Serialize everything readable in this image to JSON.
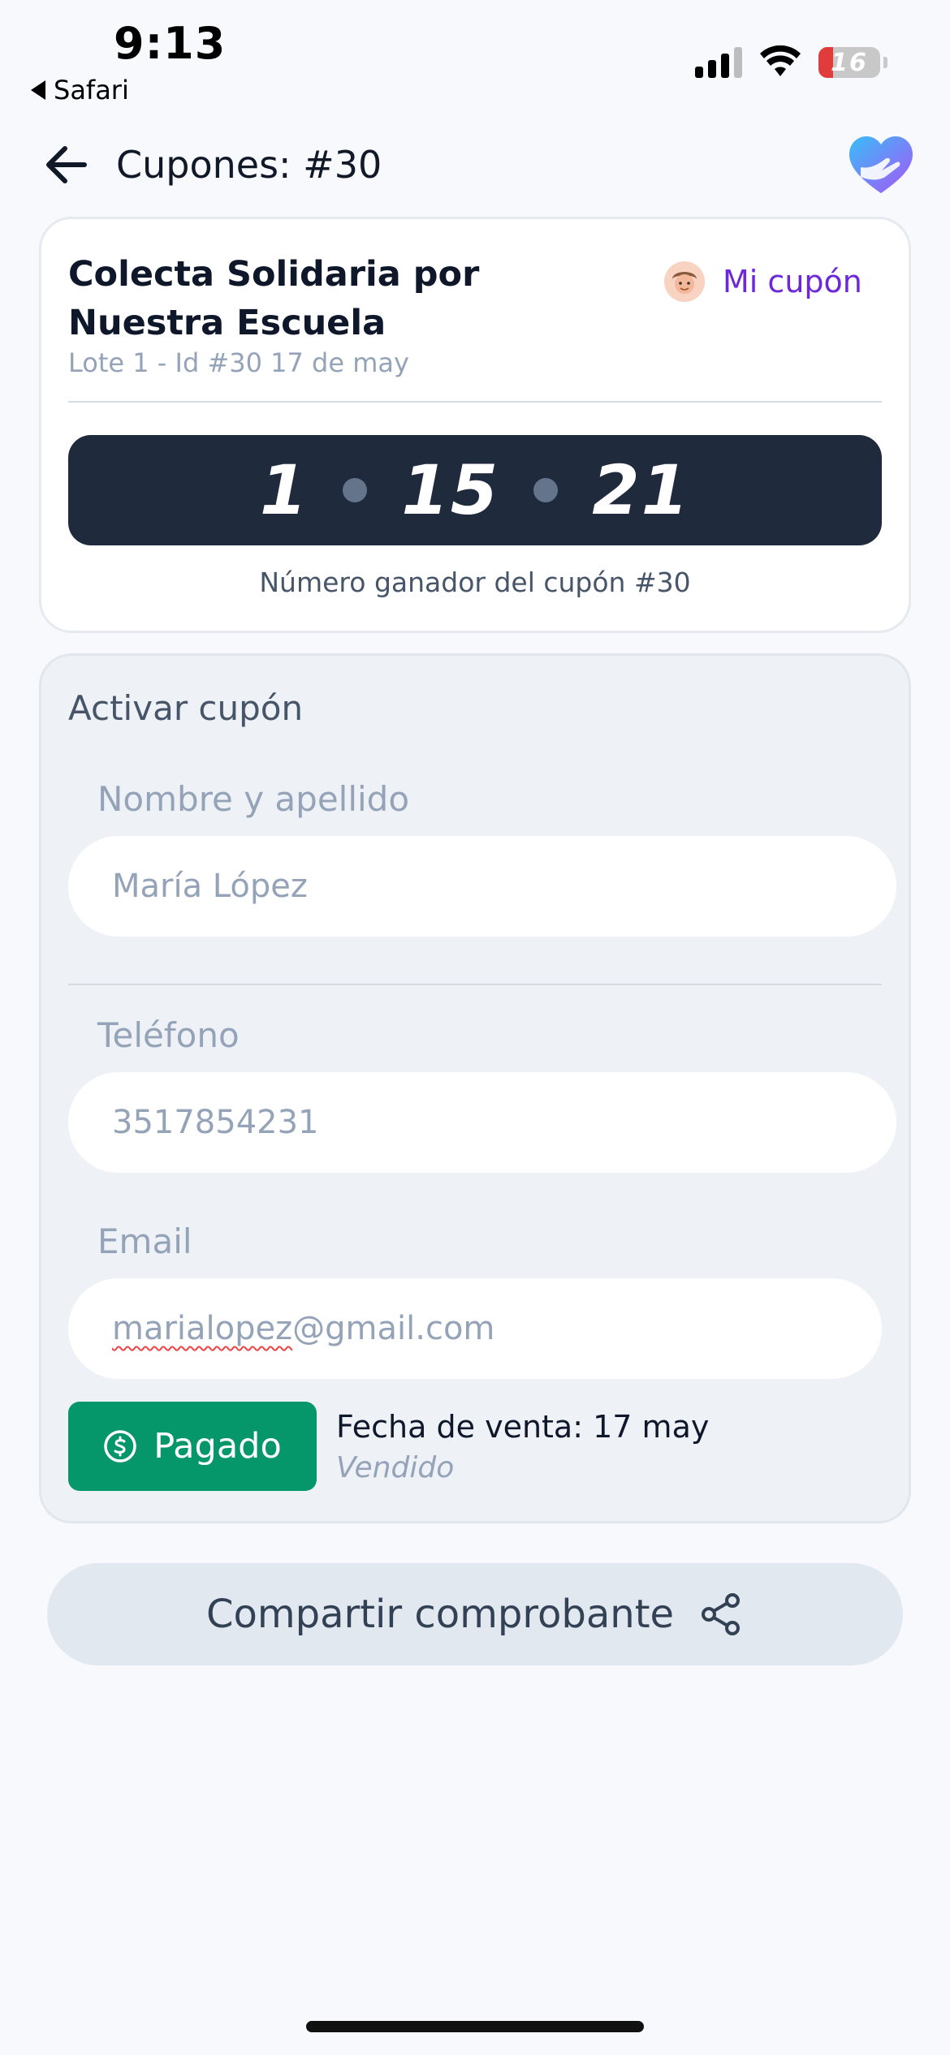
{
  "status_bar": {
    "time": "9:13",
    "back_app": "Safari",
    "battery_level": "16"
  },
  "header": {
    "title": "Cupones: #30"
  },
  "coupon_card": {
    "campaign_title": "Colecta Solidaria por Nuestra Escuela",
    "meta": "Lote 1 - Id #30  17 de may",
    "my_coupon_label": "Mi cupón",
    "winning_numbers": [
      "1",
      "15",
      "21"
    ],
    "winner_caption": "Número ganador del cupón #30"
  },
  "activate_form": {
    "section_title": "Activar cupón",
    "name_label": "Nombre y apellido",
    "name_value": "María López",
    "phone_label": "Teléfono",
    "phone_value": "3517854231",
    "email_label": "Email",
    "email_user": "marialopez",
    "email_domain": "@gmail.com",
    "paid_label": "Pagado",
    "sale_date_label": "Fecha de venta:",
    "sale_date_value": "17 may",
    "sale_status": "Vendido"
  },
  "share_button": {
    "label": "Compartir comprobante"
  },
  "colors": {
    "accent_purple": "#6d28d9",
    "paid_green": "#059669",
    "number_bar": "#1f2a3c"
  }
}
